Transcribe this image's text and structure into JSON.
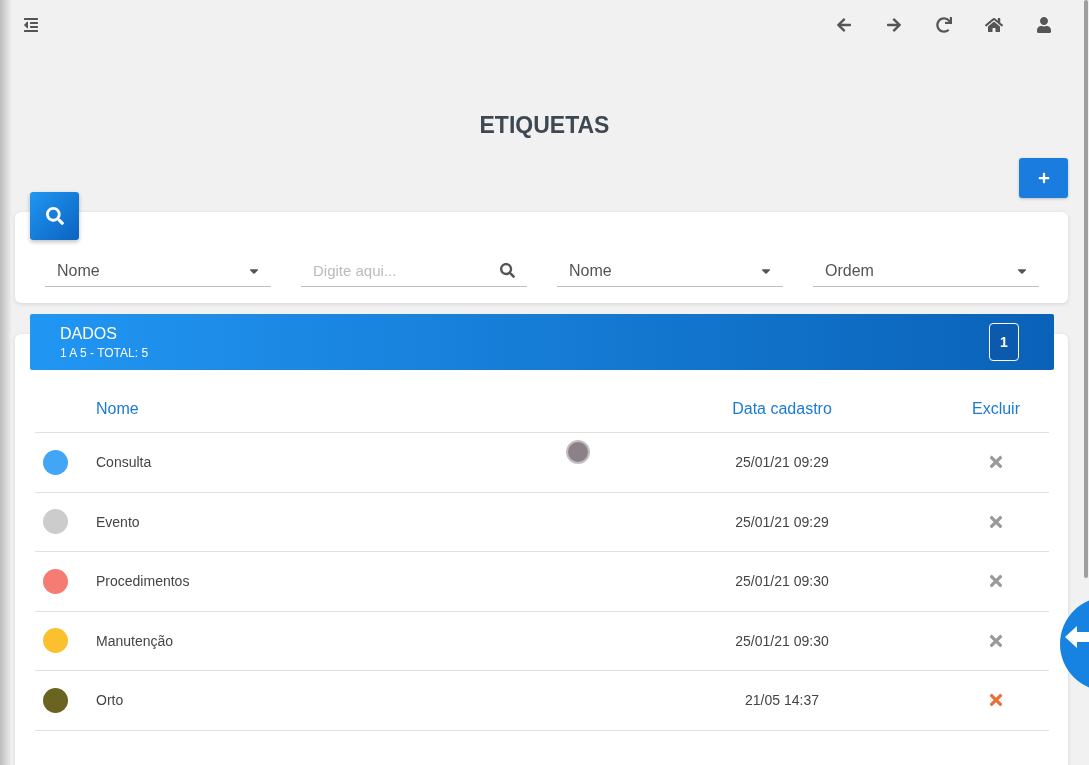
{
  "page": {
    "title": "ETIQUETAS"
  },
  "filters": [
    {
      "kind": "select",
      "value": "Nome"
    },
    {
      "kind": "search",
      "placeholder": "Digite aqui..."
    },
    {
      "kind": "select",
      "value": "Nome"
    },
    {
      "kind": "select",
      "value": "Ordem"
    }
  ],
  "data_panel": {
    "title": "DADOS",
    "summary": "1 A 5 - TOTAL: 5",
    "pages": [
      {
        "label": "1",
        "selected": true
      }
    ]
  },
  "table": {
    "columns": [
      "Nome",
      "Data cadastro",
      "Excluir"
    ],
    "rows": [
      {
        "name": "Consulta",
        "date": "25/01/21 09:29",
        "color": "#42a5f5",
        "highlighted": false
      },
      {
        "name": "Evento",
        "date": "25/01/21 09:29",
        "color": "#cccccc",
        "highlighted": false
      },
      {
        "name": "Procedimentos",
        "date": "25/01/21 09:30",
        "color": "#f47c72",
        "highlighted": false
      },
      {
        "name": "Manutenção",
        "date": "25/01/21 09:30",
        "color": "#fbc02d",
        "highlighted": false
      },
      {
        "name": "Orto",
        "date": "21/05 14:37",
        "color": "#6b6420",
        "highlighted": true
      }
    ]
  }
}
